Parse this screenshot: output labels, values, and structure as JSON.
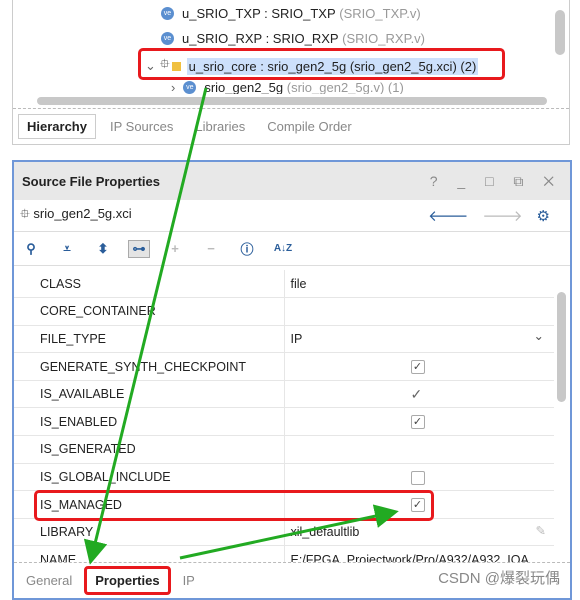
{
  "hierarchy": {
    "rows": [
      {
        "name": "u_SRIO_TXP : SRIO_TXP",
        "file": "(SRIO_TXP.v)"
      },
      {
        "name": "u_SRIO_RXP : SRIO_RXP",
        "file": "(SRIO_RXP.v)"
      },
      {
        "name": "u_srio_core : srio_gen2_5g (srio_gen2_5g.xci) (2)"
      },
      {
        "name": "srio_gen2_5g",
        "file": "(srio_gen2_5g.v) (1)"
      }
    ],
    "tabs": [
      "Hierarchy",
      "IP Sources",
      "Libraries",
      "Compile Order"
    ]
  },
  "panel": {
    "title": "Source File Properties",
    "window_buttons": "? _ □ ⧉ ✕",
    "file": "srio_gen2_5g.xci",
    "properties": [
      {
        "name": "CLASS",
        "value": "file"
      },
      {
        "name": "CORE_CONTAINER",
        "value": ""
      },
      {
        "name": "FILE_TYPE",
        "value": "IP"
      },
      {
        "name": "GENERATE_SYNTH_CHECKPOINT",
        "value": "✓"
      },
      {
        "name": "IS_AVAILABLE",
        "value": "✓"
      },
      {
        "name": "IS_ENABLED",
        "value": "✓"
      },
      {
        "name": "IS_GENERATED",
        "value": ""
      },
      {
        "name": "IS_GLOBAL_INCLUDE",
        "value": ""
      },
      {
        "name": "IS_MANAGED",
        "value": "✓"
      },
      {
        "name": "LIBRARY",
        "value": "xil_defaultlib"
      },
      {
        "name": "NAME",
        "value": "E:/FPGA_Projectwork/Pro/A932/A932_IOA"
      }
    ],
    "tabs": [
      "General",
      "Properties",
      "IP"
    ]
  },
  "watermark": "CSDN @爆裂玩偶",
  "colors": {
    "highlight": "#e8191d",
    "arrow": "#22aa22",
    "border": "#6f97d8"
  }
}
